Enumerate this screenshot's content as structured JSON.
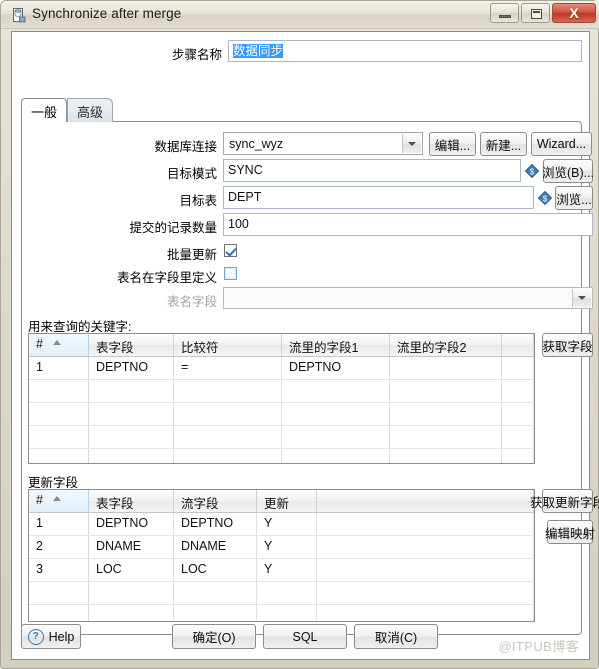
{
  "window": {
    "title": "Synchronize after merge",
    "icon": "database-step-icon",
    "buttons": {
      "minimize": "minimize-icon",
      "maximize": "maximize-icon",
      "close": "X"
    }
  },
  "step_name": {
    "label": "步骤名称",
    "value": "数据同步",
    "selected": true
  },
  "tabs": [
    {
      "label": "一般",
      "active": true
    },
    {
      "label": "高级",
      "active": false
    }
  ],
  "general": {
    "db_connection": {
      "label": "数据库连接",
      "value": "sync_wyz",
      "edit_button": "编辑...",
      "new_button": "新建...",
      "wizard_button": "Wizard..."
    },
    "target_schema": {
      "label": "目标模式",
      "value": "SYNC",
      "browse_button": "浏览(B)..."
    },
    "target_table": {
      "label": "目标表",
      "value": "DEPT",
      "browse_button": "浏览..."
    },
    "commit_size": {
      "label": "提交的记录数量",
      "value": "100"
    },
    "batch_update": {
      "label": "批量更新",
      "checked": true
    },
    "table_name_in_field": {
      "label": "表名在字段里定义",
      "checked": false
    },
    "table_name_field": {
      "label": "表名字段",
      "value": "",
      "disabled": true
    }
  },
  "keys_section": {
    "title": "用来查询的关键字:",
    "columns": [
      "#",
      "表字段",
      "比较符",
      "流里的字段1",
      "流里的字段2"
    ],
    "rows": [
      [
        "1",
        "DEPTNO",
        "=",
        "DEPTNO",
        ""
      ]
    ],
    "empty_rows": 5,
    "get_fields_button": "获取字段"
  },
  "update_section": {
    "title": "更新字段",
    "columns": [
      "#",
      "表字段",
      "流字段",
      "更新"
    ],
    "rows": [
      [
        "1",
        "DEPTNO",
        "DEPTNO",
        "Y"
      ],
      [
        "2",
        "DNAME",
        "DNAME",
        "Y"
      ],
      [
        "3",
        "LOC",
        "LOC",
        "Y"
      ]
    ],
    "empty_rows": 2,
    "get_update_fields_button": "获取更新字段",
    "edit_mapping_button": "编辑映射"
  },
  "footer": {
    "help_button": "Help",
    "ok_button": "确定(O)",
    "sql_button": "SQL",
    "cancel_button": "取消(C)",
    "watermark": "@ITPUB博客"
  }
}
